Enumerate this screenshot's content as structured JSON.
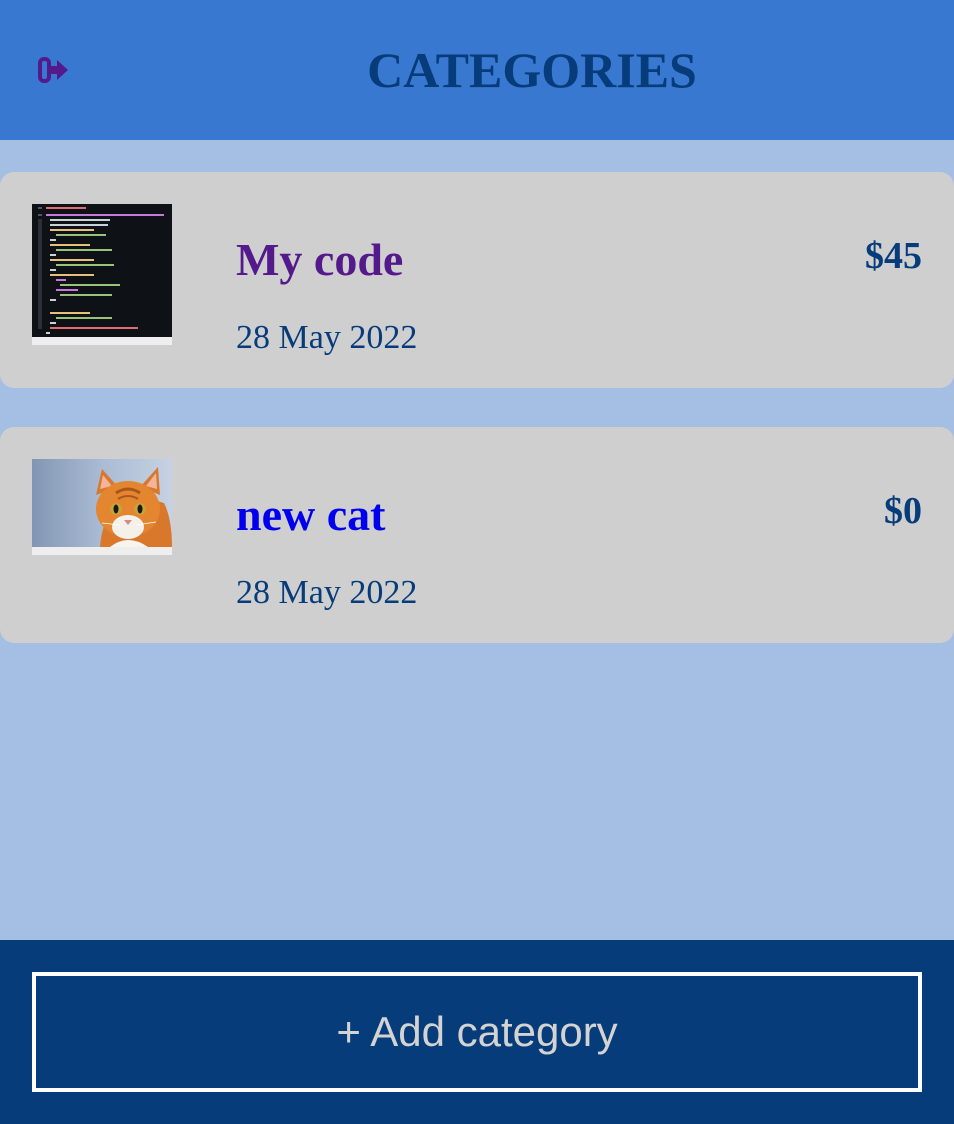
{
  "header": {
    "title": "CATEGORIES",
    "logout_icon": "logout-icon",
    "background": "#3878d0",
    "title_color": "#073c7b",
    "icon_color": "#541a8b"
  },
  "categories": [
    {
      "name": "My code",
      "date": "28 May 2022",
      "amount": "$45",
      "image": "code-screenshot-image",
      "link_state": "visited"
    },
    {
      "name": "new cat",
      "date": "28 May 2022",
      "amount": "$0",
      "image": "cat-photo-image",
      "link_state": "unvisited"
    }
  ],
  "footer": {
    "add_button_label": "+ Add category",
    "background": "#073c7b"
  },
  "colors": {
    "page_background": "#a5bfe4",
    "card_background": "#cfcfcf",
    "visited_link": "#541a8b",
    "unvisited_link": "#0000ee"
  }
}
